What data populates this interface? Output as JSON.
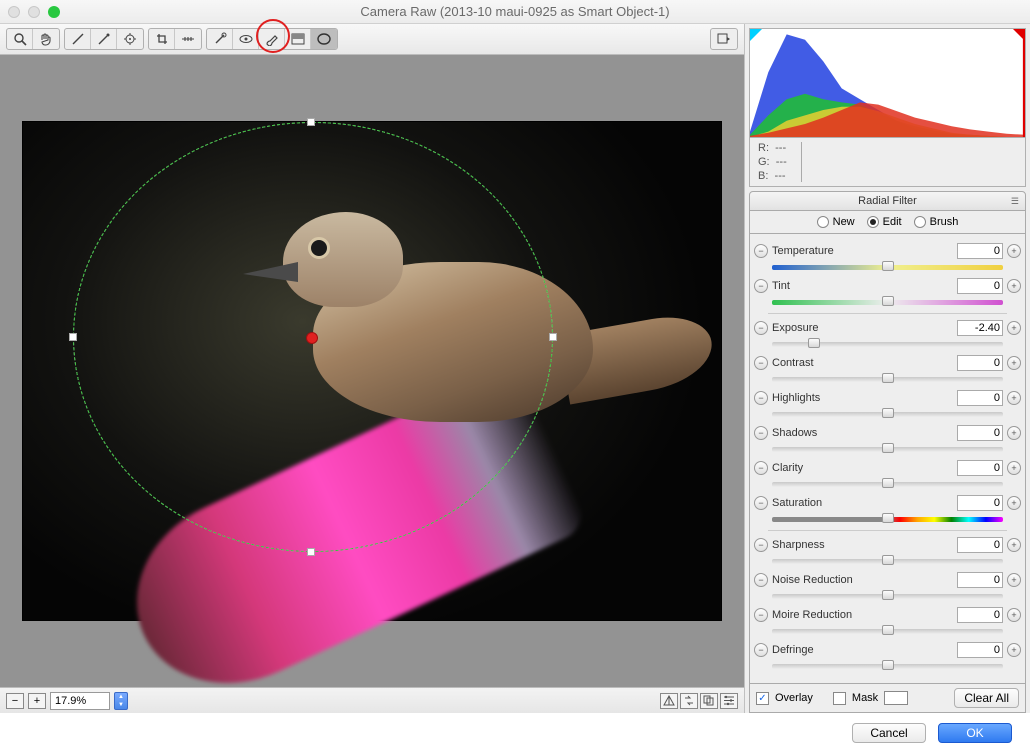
{
  "window": {
    "title": "Camera Raw (2013-10 maui-0925 as Smart Object-1)"
  },
  "toolbar": {
    "tools": [
      "zoom-tool",
      "hand-tool",
      "white-balance-tool",
      "color-sampler-tool",
      "targeted-adjustment-tool",
      "crop-tool",
      "straighten-tool",
      "spot-removal-tool",
      "red-eye-tool",
      "adjustment-brush-tool",
      "graduated-filter-tool",
      "radial-filter-tool"
    ],
    "active_tool": "radial-filter-tool"
  },
  "zoom": {
    "value": "17.9%"
  },
  "rgb": {
    "R": "---",
    "G": "---",
    "B": "---"
  },
  "panel": {
    "title": "Radial Filter",
    "modes": {
      "new": "New",
      "edit": "Edit",
      "brush": "Brush",
      "selected": "edit"
    }
  },
  "sliders": {
    "temperature": {
      "label": "Temperature",
      "value": "0",
      "pos": 50
    },
    "tint": {
      "label": "Tint",
      "value": "0",
      "pos": 50
    },
    "exposure": {
      "label": "Exposure",
      "value": "-2.40",
      "pos": 18
    },
    "contrast": {
      "label": "Contrast",
      "value": "0",
      "pos": 50
    },
    "highlights": {
      "label": "Highlights",
      "value": "0",
      "pos": 50
    },
    "shadows": {
      "label": "Shadows",
      "value": "0",
      "pos": 50
    },
    "clarity": {
      "label": "Clarity",
      "value": "0",
      "pos": 50
    },
    "saturation": {
      "label": "Saturation",
      "value": "0",
      "pos": 50
    },
    "sharpness": {
      "label": "Sharpness",
      "value": "0",
      "pos": 50
    },
    "noise": {
      "label": "Noise Reduction",
      "value": "0",
      "pos": 50
    },
    "moire": {
      "label": "Moire Reduction",
      "value": "0",
      "pos": 50
    },
    "defringe": {
      "label": "Defringe",
      "value": "0",
      "pos": 50
    }
  },
  "overlay": {
    "overlay_label": "Overlay",
    "overlay_checked": true,
    "mask_label": "Mask",
    "mask_checked": false,
    "clear": "Clear All"
  },
  "footer": {
    "cancel": "Cancel",
    "ok": "OK"
  },
  "chart_data": {
    "type": "area",
    "note": "RGB histogram",
    "xlim": [
      0,
      255
    ],
    "ylim": [
      0,
      1
    ],
    "series": [
      {
        "name": "blue",
        "color": "#2040e0",
        "values": [
          0.05,
          0.6,
          0.95,
          0.9,
          0.7,
          0.45,
          0.35,
          0.25,
          0.15,
          0.08,
          0.04,
          0.02,
          0.01,
          0,
          0,
          0
        ]
      },
      {
        "name": "green",
        "color": "#20c030",
        "values": [
          0.02,
          0.2,
          0.35,
          0.4,
          0.35,
          0.32,
          0.3,
          0.22,
          0.15,
          0.1,
          0.06,
          0.03,
          0.02,
          0.01,
          0,
          0
        ]
      },
      {
        "name": "yellow",
        "color": "#e8d030",
        "values": [
          0,
          0.05,
          0.15,
          0.2,
          0.25,
          0.28,
          0.28,
          0.24,
          0.18,
          0.12,
          0.08,
          0.04,
          0.02,
          0.01,
          0,
          0
        ]
      },
      {
        "name": "red",
        "color": "#e03020",
        "values": [
          0.01,
          0.04,
          0.08,
          0.12,
          0.18,
          0.25,
          0.32,
          0.3,
          0.24,
          0.18,
          0.14,
          0.1,
          0.07,
          0.05,
          0.03,
          0.02
        ]
      }
    ]
  }
}
